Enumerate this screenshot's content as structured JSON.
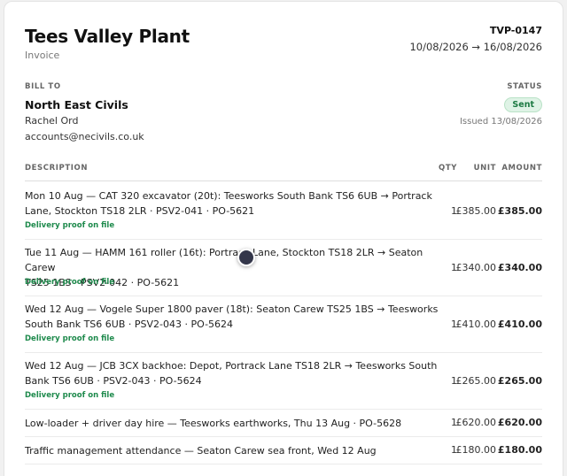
{
  "vendor": {
    "name": "Tees Valley Plant",
    "doc_type": "Invoice"
  },
  "invoice": {
    "number": "TVP-0147",
    "period": "10/08/2026 → 16/08/2026"
  },
  "bill_to": {
    "label": "BILL TO",
    "client": "North East Civils",
    "contact": "Rachel Ord",
    "email": "accounts@necivils.co.uk"
  },
  "status": {
    "label": "STATUS",
    "value": "Sent",
    "issued": "Issued 13/08/2026",
    "color": "#1c7a43"
  },
  "table": {
    "headers": {
      "description": "DESCRIPTION",
      "qty": "QTY",
      "unit": "UNIT",
      "amount": "AMOUNT"
    },
    "rows": [
      {
        "line1": "Mon 10 Aug — CAT 320 excavator (20t): Teesworks South Bank TS6 6UB → Portrack",
        "line2": "Lane, Stockton TS18 2LR · PSV2-041 · PO-5621",
        "proof": "Delivery proof on file",
        "qty": "1",
        "unit": "£385.00",
        "amount": "£385.00"
      },
      {
        "line1": "Tue 11 Aug — HAMM 161 roller (16t): Portrack Lane, Stockton TS18 2LR → Seaton Carew",
        "line2": "TS25 1BS · PSV2-042 · PO-5621",
        "proof": "Delivery proof on file",
        "qty": "1",
        "unit": "£340.00",
        "amount": "£340.00"
      },
      {
        "line1": "Wed 12 Aug — Vogele Super 1800 paver (18t): Seaton Carew TS25 1BS → Teesworks",
        "line2": "South Bank TS6 6UB · PSV2-043 · PO-5624",
        "proof": "Delivery proof on file",
        "qty": "1",
        "unit": "£410.00",
        "amount": "£410.00"
      },
      {
        "line1": "Wed 12 Aug — JCB 3CX backhoe: Depot, Portrack Lane TS18 2LR → Teesworks South",
        "line2": "Bank TS6 6UB · PSV2-043 · PO-5624",
        "proof": "Delivery proof on file",
        "qty": "1",
        "unit": "£265.00",
        "amount": "£265.00"
      },
      {
        "line1": "Low-loader + driver day hire — Teesworks earthworks, Thu 13 Aug · PO-5628",
        "qty": "1",
        "unit": "£620.00",
        "amount": "£620.00"
      },
      {
        "line1": "Traffic management attendance — Seaton Carew sea front, Wed 12 Aug",
        "qty": "1",
        "unit": "£180.00",
        "amount": "£180.00"
      }
    ]
  }
}
